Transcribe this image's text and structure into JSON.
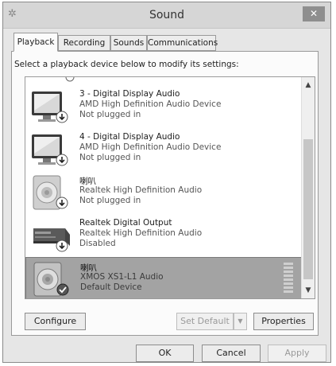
{
  "window": {
    "title": "Sound",
    "app_icon": "speaker-settings-icon",
    "close_glyph": "✕"
  },
  "tabs": [
    {
      "label": "Playback",
      "active": true
    },
    {
      "label": "Recording",
      "active": false
    },
    {
      "label": "Sounds",
      "active": false
    },
    {
      "label": "Communications",
      "active": false
    }
  ],
  "instruction": "Select a playback device below to modify its settings:",
  "devices": [
    {
      "name": "3 - Digital Display Audio",
      "driver": "AMD High Definition Audio Device",
      "status": "Not plugged in",
      "icon": "monitor-icon",
      "badge": "down-arrow-badge-icon",
      "selected": false
    },
    {
      "name": "4 - Digital Display Audio",
      "driver": "AMD High Definition Audio Device",
      "status": "Not plugged in",
      "icon": "monitor-icon",
      "badge": "down-arrow-badge-icon",
      "selected": false
    },
    {
      "name": "喇叭",
      "driver": "Realtek High Definition Audio",
      "status": "Not plugged in",
      "icon": "speaker-icon",
      "badge": "down-arrow-badge-icon",
      "selected": false
    },
    {
      "name": "Realtek Digital Output",
      "driver": "Realtek High Definition Audio",
      "status": "Disabled",
      "icon": "digital-output-receiver-icon",
      "badge": "down-arrow-badge-icon",
      "selected": false
    },
    {
      "name": "喇叭",
      "driver": "XMOS XS1-L1 Audio",
      "status": "Default Device",
      "icon": "speaker-icon",
      "badge": "check-badge-icon",
      "selected": true
    }
  ],
  "scroll": {
    "up_glyph": "▲",
    "down_glyph": "▼"
  },
  "buttons": {
    "configure": "Configure",
    "set_default": "Set Default",
    "set_default_arrow": "▼",
    "properties": "Properties",
    "ok": "OK",
    "cancel": "Cancel",
    "apply": "Apply"
  },
  "colors": {
    "selection": "#a3a3a3",
    "panel": "#fbfbfb",
    "window": "#e6e6e6"
  }
}
